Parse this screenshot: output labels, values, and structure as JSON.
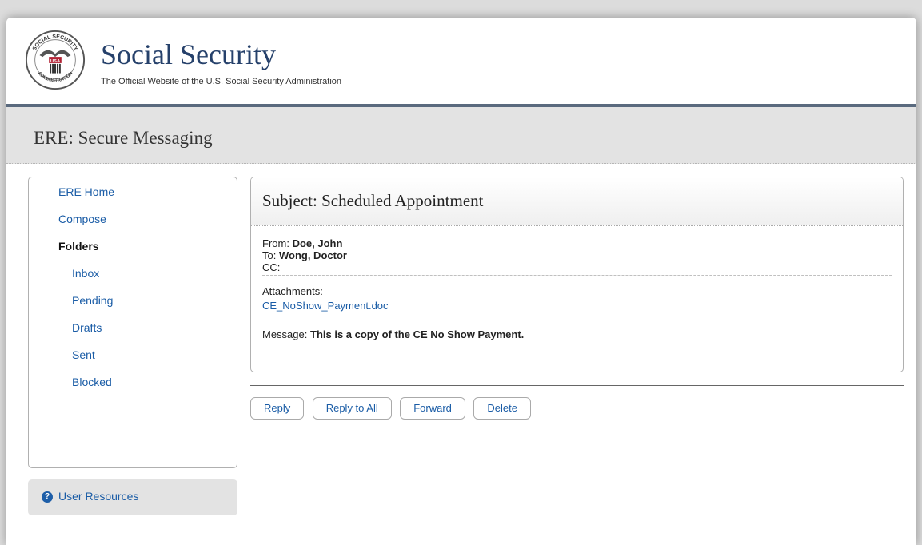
{
  "brand": {
    "title": "Social Security",
    "subtitle": "The Official Website of the U.S. Social Security Administration",
    "seal_text_top": "SOCIAL SECURITY",
    "seal_text_center": "USA",
    "seal_text_bottom": "ADMINISTRATION",
    "color_navy": "#26416b"
  },
  "section": {
    "title": "ERE: Secure Messaging"
  },
  "sidebar": {
    "items": [
      {
        "label": "ERE Home",
        "type": "link"
      },
      {
        "label": "Compose",
        "type": "link"
      },
      {
        "label": "Folders",
        "type": "heading"
      },
      {
        "label": "Inbox",
        "type": "sub"
      },
      {
        "label": "Pending",
        "type": "sub"
      },
      {
        "label": "Drafts",
        "type": "sub"
      },
      {
        "label": "Sent",
        "type": "sub"
      },
      {
        "label": "Blocked",
        "type": "sub"
      }
    ],
    "resources_label": "User Resources",
    "resources_icon": "question-circle-icon"
  },
  "message": {
    "subject_prefix": "Subject:",
    "subject": "Scheduled Appointment",
    "from_label": "From:",
    "from_value": "Doe, John",
    "to_label": "To:",
    "to_value": "Wong, Doctor",
    "cc_label": "CC:",
    "cc_value": "",
    "attachments_label": "Attachments:",
    "attachment": "CE_NoShow_Payment.doc",
    "message_label": "Message:",
    "message_value": "This is a copy of the CE No Show Payment."
  },
  "actions": {
    "reply": "Reply",
    "reply_all": "Reply to All",
    "forward": "Forward",
    "delete": "Delete"
  },
  "colors": {
    "link": "#1a5ca6",
    "header_bar": "#5a6a7e",
    "section_bg": "#e3e3e3"
  }
}
